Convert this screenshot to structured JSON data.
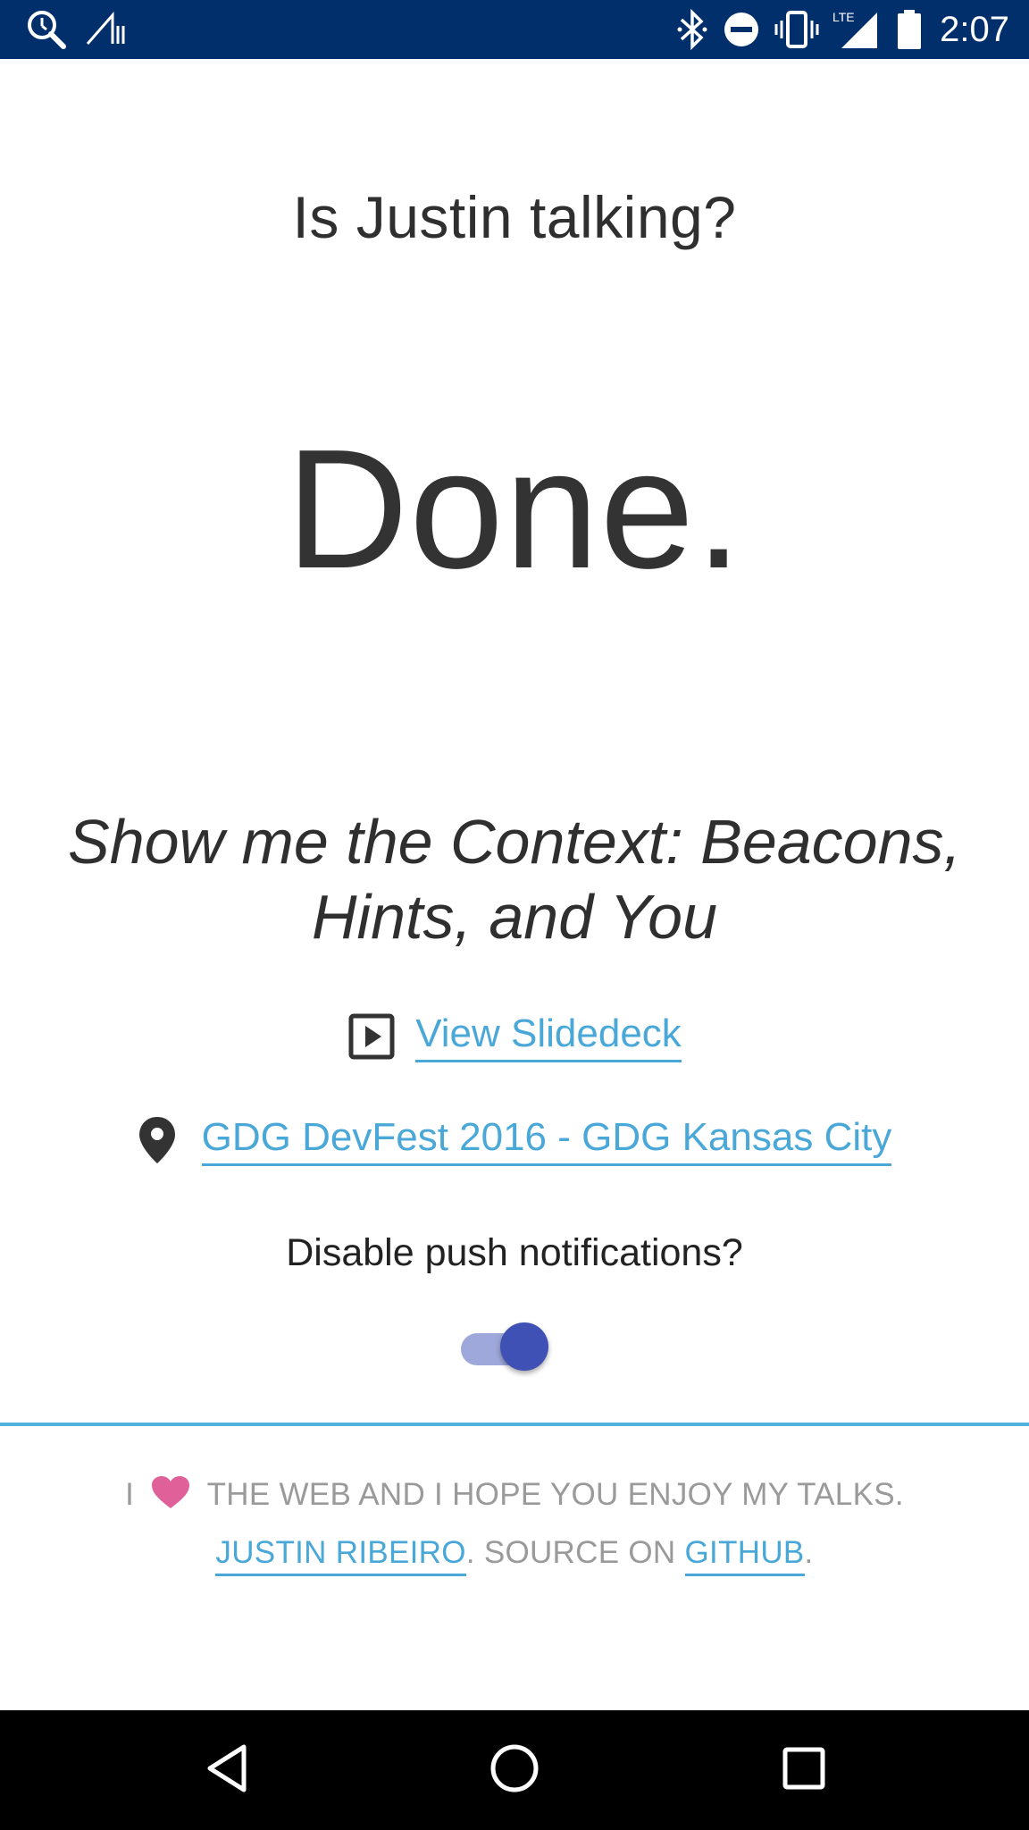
{
  "status_bar": {
    "time": "2:07",
    "icons": [
      "location-search-icon",
      "signal-data-icon",
      "bluetooth-icon",
      "do-not-disturb-icon",
      "vibrate-icon",
      "lte-signal-icon",
      "battery-icon"
    ],
    "lte_label": "LTE",
    "background": "#002f6c"
  },
  "main": {
    "question": "Is Justin talking?",
    "answer": "Done.",
    "talk_title": "Show me the Context: Beacons, Hints, and You",
    "slides_link": "View Slidedeck",
    "event_link": "GDG DevFest 2016 - GDG Kansas City",
    "push_label": "Disable push notifications?",
    "push_toggle_on": true
  },
  "footer": {
    "line1_before": "I",
    "line1_after": "THE WEB AND I HOPE YOU ENJOY MY TALKS.",
    "author_link": "JUSTIN RIBEIRO",
    "source_text": ". SOURCE ON ",
    "github_link": "GITHUB",
    "end_period": "."
  },
  "nav_bar": {
    "icons": [
      "back-icon",
      "home-icon",
      "recents-icon"
    ]
  },
  "colors": {
    "accent_link": "#4aa8d8",
    "toggle_thumb": "#3f51b5",
    "toggle_track": "#9fa8da",
    "heart": "#e0609a",
    "divider": "#4fb3dc"
  }
}
